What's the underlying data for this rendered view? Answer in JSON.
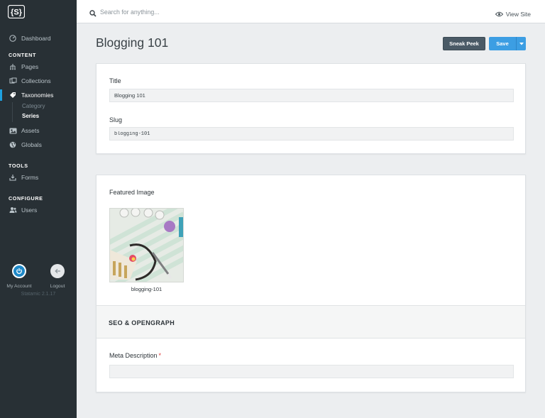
{
  "sidebar": {
    "nav": {
      "dashboard": "Dashboard",
      "pages": "Pages",
      "collections": "Collections",
      "taxonomies": "Taxonomies",
      "assets": "Assets",
      "globals": "Globals",
      "forms": "Forms",
      "users": "Users"
    },
    "sections": {
      "content": "CONTENT",
      "tools": "TOOLS",
      "configure": "CONFIGURE"
    },
    "taxonomy_sub": {
      "category": "Category",
      "series": "Series"
    },
    "account": {
      "my_account": "My Account",
      "logout": "Logout"
    },
    "version": "Statamic 2.1.17"
  },
  "topbar": {
    "search_placeholder": "Search for anything...",
    "view_site": "View Site"
  },
  "header": {
    "title": "Blogging 101",
    "sneak_peek": "Sneak Peek",
    "save": "Save"
  },
  "form": {
    "title_label": "Title",
    "title_value": "Blogging 101",
    "slug_label": "Slug",
    "slug_value": "blogging-101"
  },
  "media": {
    "featured_image_label": "Featured Image",
    "image_caption": "blogging-101",
    "seo_heading": "SEO & OPENGRAPH",
    "meta_description_label": "Meta Description",
    "required_mark": "*",
    "meta_description_value": ""
  },
  "colors": {
    "sidebar_bg": "#283035",
    "accent": "#1ea1e0",
    "save_button": "#3c9ee3",
    "sneak_peek_button": "#4a5a66",
    "required": "#e03c3c"
  }
}
